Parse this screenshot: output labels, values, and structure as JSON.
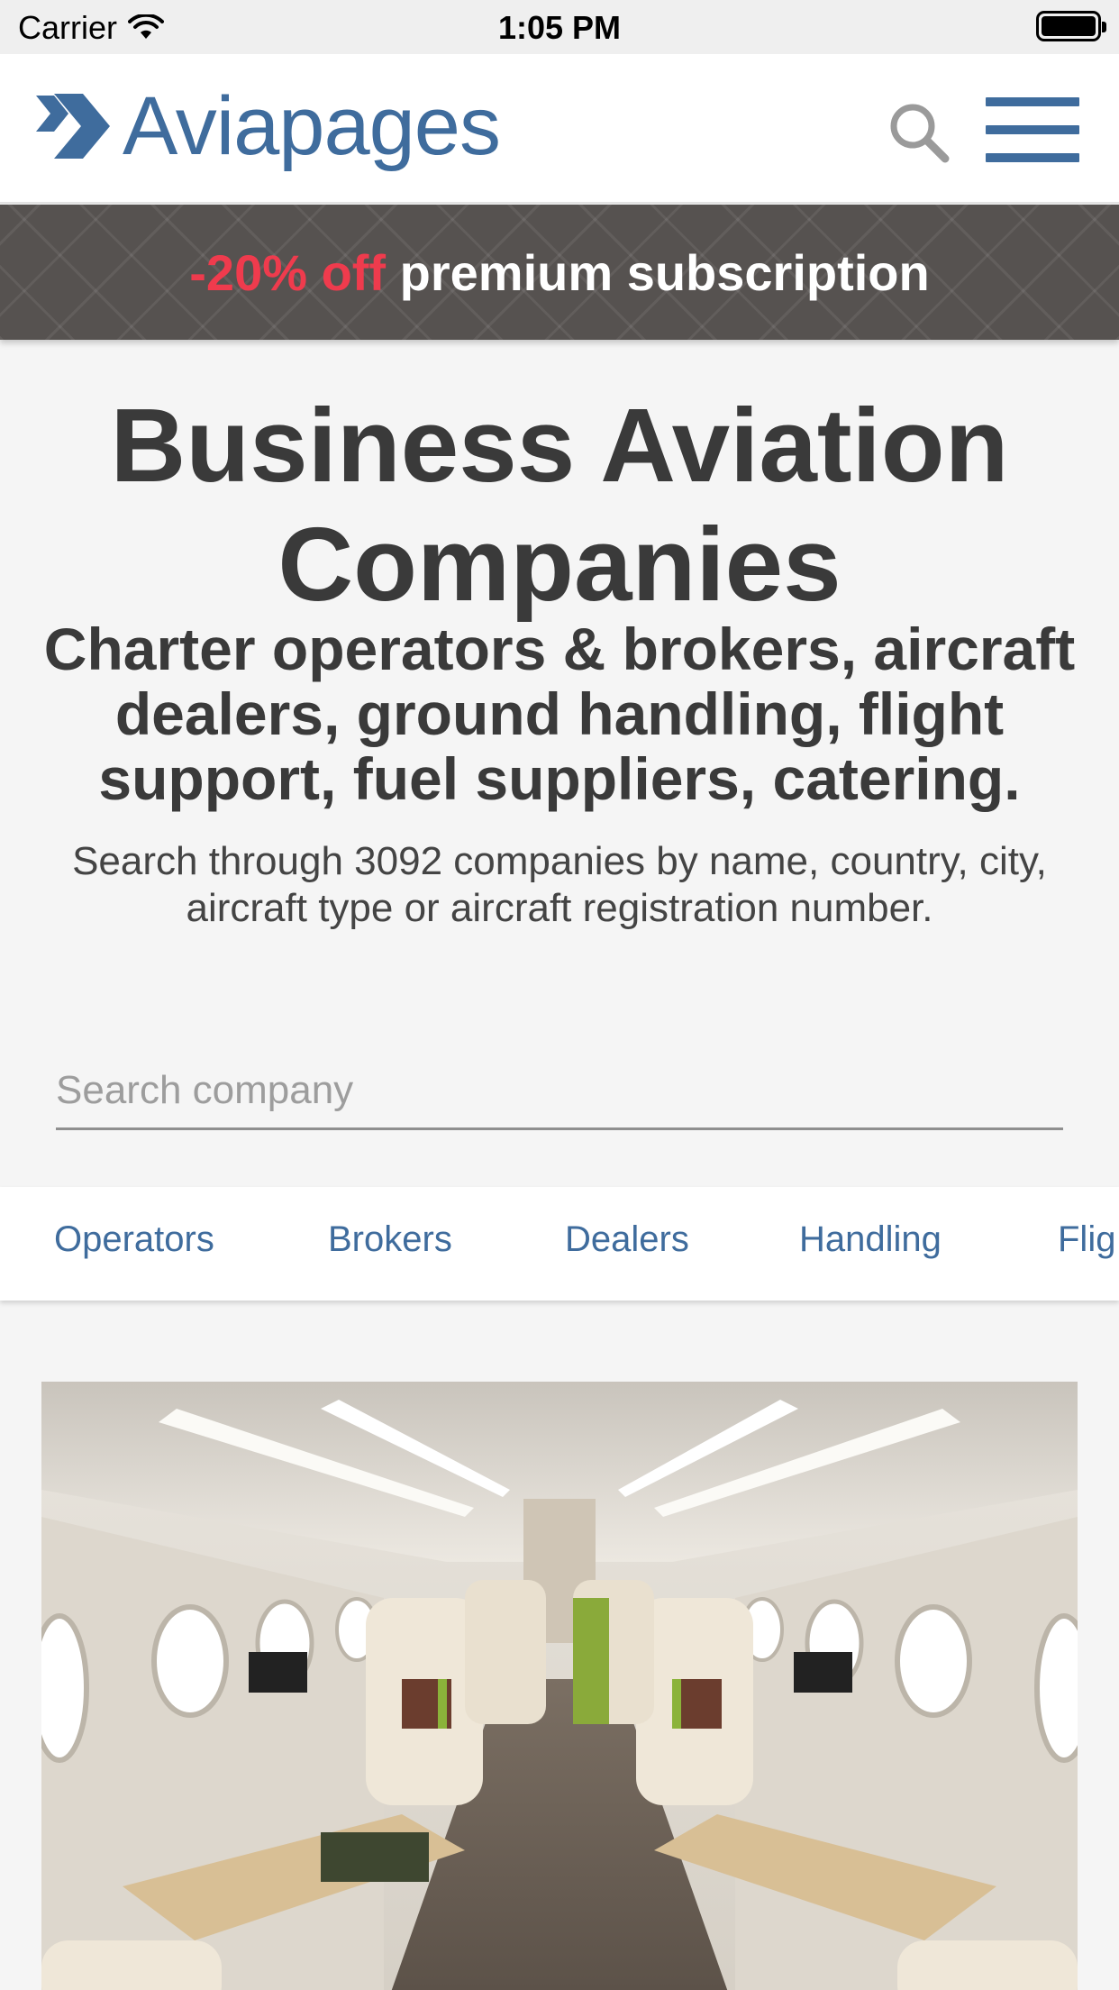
{
  "status_bar": {
    "carrier": "Carrier",
    "time": "1:05 PM"
  },
  "header": {
    "logo_text": "Aviapages",
    "brand_color": "#3f6c9d",
    "icons": [
      "logo-chevron-icon",
      "search-icon",
      "hamburger-menu-icon"
    ]
  },
  "promo": {
    "discount": "-20% off",
    "rest": " premium subscription",
    "discount_color": "#ef3b4d"
  },
  "hero": {
    "title": "Business Aviation Companies",
    "subtitle": "Charter operators & brokers, aircraft dealers, ground handling, flight support, fuel suppliers, catering.",
    "description": "Search through 3092 companies by name, country, city, aircraft type or aircraft registration number."
  },
  "search": {
    "placeholder": "Search company",
    "value": ""
  },
  "tabs": [
    "Operators",
    "Brokers",
    "Dealers",
    "Handling",
    "Flig"
  ]
}
